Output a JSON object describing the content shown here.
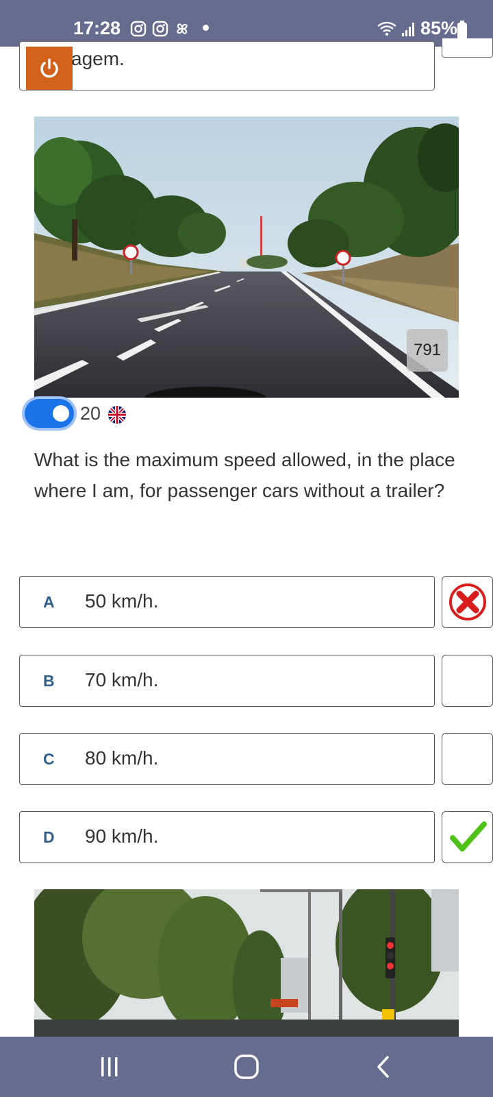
{
  "status_bar": {
    "time": "17:28",
    "battery": "85%"
  },
  "top_card": {
    "partial_text": "agem."
  },
  "question_image": {
    "number_badge": "791"
  },
  "translation": {
    "count": "20"
  },
  "question": {
    "text": "What is the maximum speed allowed, in the place where I am, for passenger cars without a trailer?"
  },
  "answers": [
    {
      "letter": "A",
      "text": "50 km/h.",
      "mark": "wrong"
    },
    {
      "letter": "B",
      "text": "70 km/h.",
      "mark": "none"
    },
    {
      "letter": "C",
      "text": "80 km/h.",
      "mark": "none"
    },
    {
      "letter": "D",
      "text": "90 km/h.",
      "mark": "correct"
    }
  ],
  "colors": {
    "status_bar_bg": "#676b8e",
    "power_button": "#d2611c",
    "toggle_on": "#1a73e8",
    "answer_letter": "#2f5f8a",
    "wrong_mark": "#d81d1d",
    "correct_mark": "#4fc21a"
  }
}
